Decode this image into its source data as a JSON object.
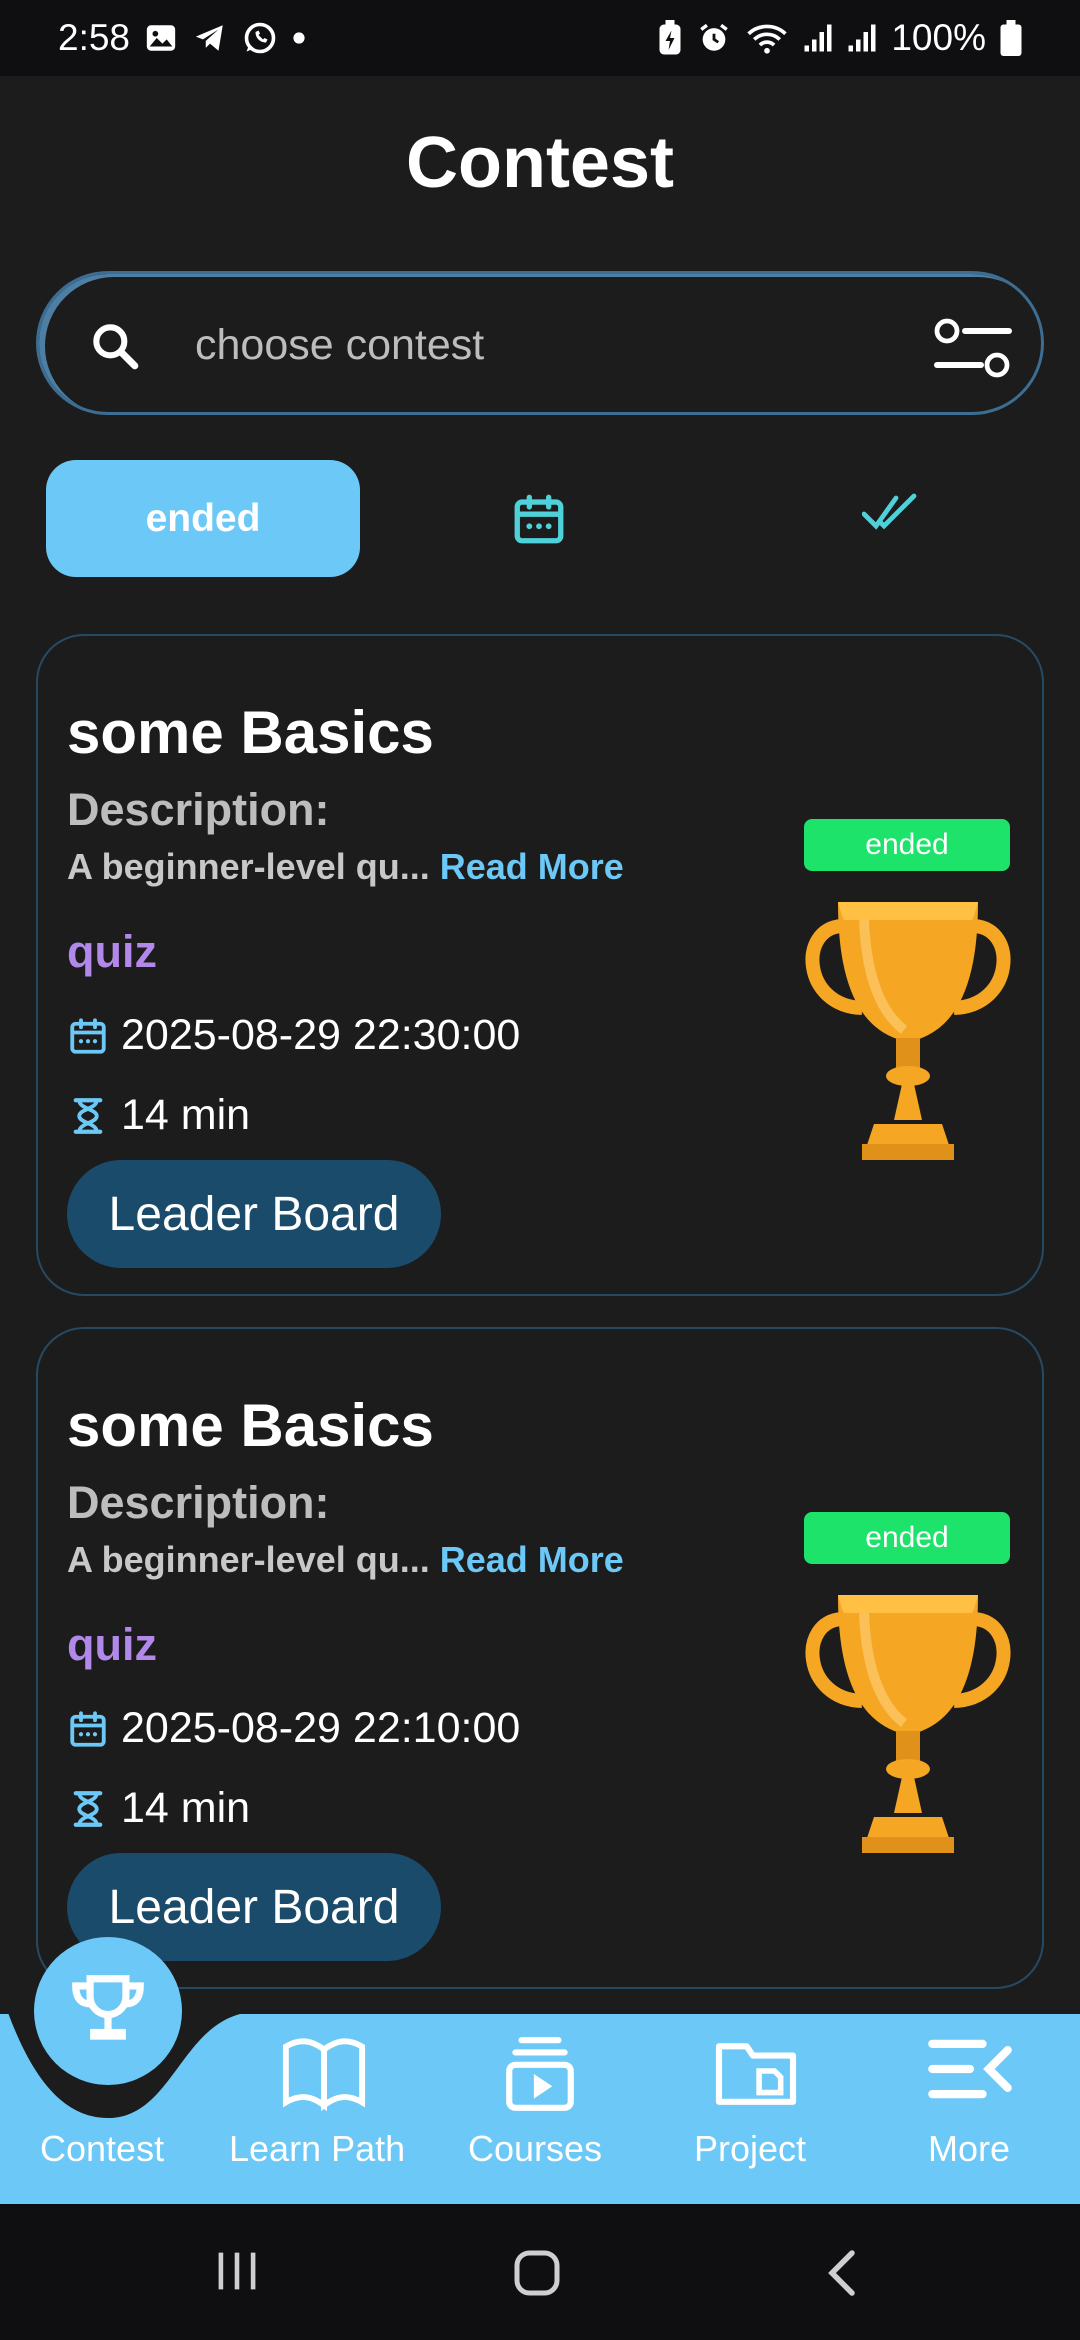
{
  "status_bar": {
    "time": "2:58",
    "battery": "100%",
    "icons": [
      "gallery-icon",
      "telegram-icon",
      "whatsapp-icon",
      "dot-icon",
      "battery-saver-icon",
      "alarm-icon",
      "wifi-icon",
      "signal-icon",
      "signal-icon",
      "battery-icon"
    ]
  },
  "header": {
    "title": "Contest"
  },
  "search": {
    "placeholder": "choose contest",
    "value": ""
  },
  "tabs": [
    {
      "label": "ended",
      "selected": true
    },
    {
      "icon": "calendar-icon",
      "selected": false
    },
    {
      "icon": "double-check-icon",
      "selected": false
    }
  ],
  "cards": [
    {
      "title": "some Basics",
      "description_label": "Description:",
      "description": "A beginner-level qu...",
      "read_more": " Read More",
      "type": "quiz",
      "datetime": "2025-08-29 22:30:00",
      "duration": "14 min",
      "button": "Leader Board",
      "status": "ended"
    },
    {
      "title": "some Basics",
      "description_label": "Description:",
      "description": "A beginner-level qu...",
      "read_more": " Read More",
      "type": "quiz",
      "datetime": "2025-08-29 22:10:00",
      "duration": "14 min",
      "button": "Leader Board",
      "status": "ended"
    }
  ],
  "bottom_nav": [
    {
      "label": "Contest",
      "icon": "trophy-icon",
      "active": true
    },
    {
      "label": "Learn Path",
      "icon": "book-icon",
      "active": false
    },
    {
      "label": "Courses",
      "icon": "courses-icon",
      "active": false
    },
    {
      "label": "Project",
      "icon": "folder-icon",
      "active": false
    },
    {
      "label": "More",
      "icon": "menu-collapse-icon",
      "active": false
    }
  ],
  "colors": {
    "background": "#1c1c1c",
    "accent": "#6cc8f6",
    "badge_green": "#1ee36b",
    "quiz_purple": "#b388eb",
    "button_blue": "#1b4b6a",
    "trophy_gold": "#f5a623"
  }
}
